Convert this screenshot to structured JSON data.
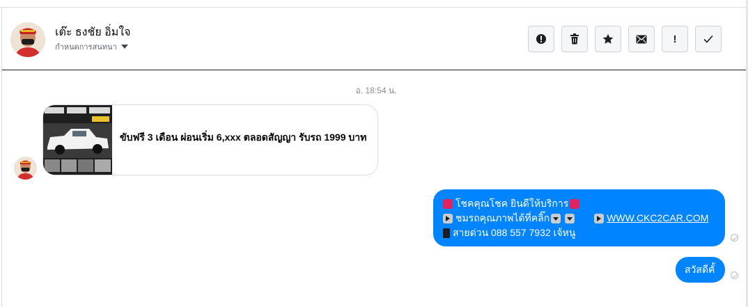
{
  "header": {
    "contact_name": "เต๊ะ ธงชัย อิ่มใจ",
    "subtitle": "กำหนดการสนทนา",
    "tools": [
      {
        "icon": "alert-circle-icon",
        "glyph": "!"
      },
      {
        "icon": "trash-icon",
        "glyph": ""
      },
      {
        "icon": "star-icon",
        "glyph": "★"
      },
      {
        "icon": "mail-icon",
        "glyph": "✉"
      },
      {
        "icon": "exclamation-icon",
        "glyph": "!"
      },
      {
        "icon": "check-icon",
        "glyph": "✓"
      }
    ]
  },
  "conversation": {
    "timestamp": "อ. 18:54 น.",
    "incoming_card": {
      "text": "ขับฟรี 3 เดือน ผ่อนเริ่ม 6,xxx ตลอดสัญญา รับรถ 1999 บาท"
    },
    "outgoing_1": {
      "line1": "โชคคุณโชค ยินดีให้บริการ",
      "line2_text": "ชมรถคุณภาพได้ที่คลิ๊ก",
      "line2_link": "WWW.CKC2CAR.COM",
      "line3": "สายด่วน 088 557 7932 เจ้หนู"
    },
    "outgoing_2": {
      "text": "สวัสดีคั้"
    }
  },
  "colors": {
    "outgoing_bubble": "#0084ff",
    "border": "#dadde1",
    "muted_text": "#8a8d91"
  }
}
